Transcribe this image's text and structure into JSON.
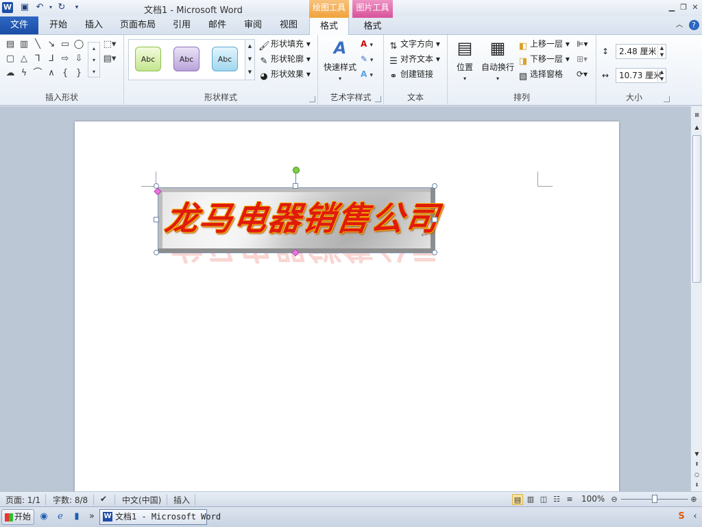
{
  "app": {
    "window_title": "文档1  -  Microsoft Word",
    "context_tabs": [
      {
        "label": "绘图工具",
        "color": "#f1a441"
      },
      {
        "label": "图片工具",
        "color": "#d9579e"
      }
    ]
  },
  "tabs": {
    "file": "文件",
    "items": [
      "开始",
      "插入",
      "页面布局",
      "引用",
      "邮件",
      "审阅",
      "视图"
    ],
    "format1": "格式",
    "format2": "格式"
  },
  "ribbon": {
    "groups": {
      "insert_shapes": "插入形状",
      "shape_styles": "形状样式",
      "wordart_styles": "艺术字样式",
      "text": "文本",
      "arrange": "排列",
      "size": "大小"
    },
    "gallery": [
      "Abc",
      "Abc",
      "Abc"
    ],
    "shape_fill": "形状填充",
    "shape_outline": "形状轮廓",
    "shape_effects": "形状效果",
    "quick_styles": "快速样式",
    "text_direction": "文字方向",
    "align_text": "对齐文本",
    "create_link": "创建链接",
    "position": "位置",
    "wrap_text": "自动换行",
    "bring_forward": "上移一层",
    "send_backward": "下移一层",
    "selection_pane": "选择窗格",
    "height_value": "2.48 厘米",
    "width_value": "10.73 厘米"
  },
  "document": {
    "wordart_text": "龙马电器销售公司"
  },
  "status": {
    "page": "页面: 1/1",
    "words": "字数: 8/8",
    "language": "中文(中国)",
    "mode": "插入",
    "zoom": "100%",
    "zoom_level": 1.0
  },
  "taskbar": {
    "start": "开始",
    "task_label": "文档1 - Microsoft Word"
  },
  "colors": {
    "accent": "#2b579a",
    "wordart_fill": "#e01b0c",
    "wordart_outline": "#f5b400"
  }
}
